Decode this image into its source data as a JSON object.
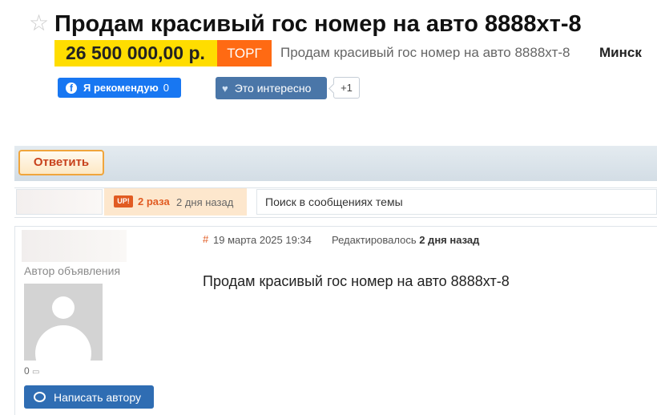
{
  "header": {
    "title": "Продам красивый гос номер на авто 8888хт-8",
    "price": "26 500 000,00 р.",
    "negotiable_label": "ТОРГ",
    "subtitle": "Продам красивый гос номер на авто 8888хт-8",
    "city": "Минск"
  },
  "social": {
    "facebook_label": "Я рекомендую",
    "facebook_count": "0",
    "like_label": "Это интересно",
    "like_count": "+1"
  },
  "toolbar": {
    "reply_label": "Ответить"
  },
  "topic_bar": {
    "up_badge": "UP!",
    "up_count": "2 раза",
    "up_time": "2 дня назад",
    "search_placeholder": "Поиск в сообщениях темы"
  },
  "post": {
    "author_role": "Автор объявления",
    "message_count": "0",
    "write_author_label": "Написать автору",
    "hash": "#",
    "date": "19 марта 2025 19:34",
    "edited_label": "Редактировалось",
    "edited_time": "2 дня назад",
    "message": "Продам красивый гос номер на авто 8888хт-8"
  },
  "colors": {
    "price_bg": "#ffdd00",
    "torg_bg": "#ff6a13",
    "facebook": "#1877f2",
    "like": "#4a76a8",
    "accent": "#e15b22",
    "write_button": "#2f6db3"
  },
  "icons": [
    "star-icon",
    "facebook-icon",
    "heart-icon",
    "comment-icon",
    "chat-bubble-icon",
    "user-avatar-icon"
  ]
}
